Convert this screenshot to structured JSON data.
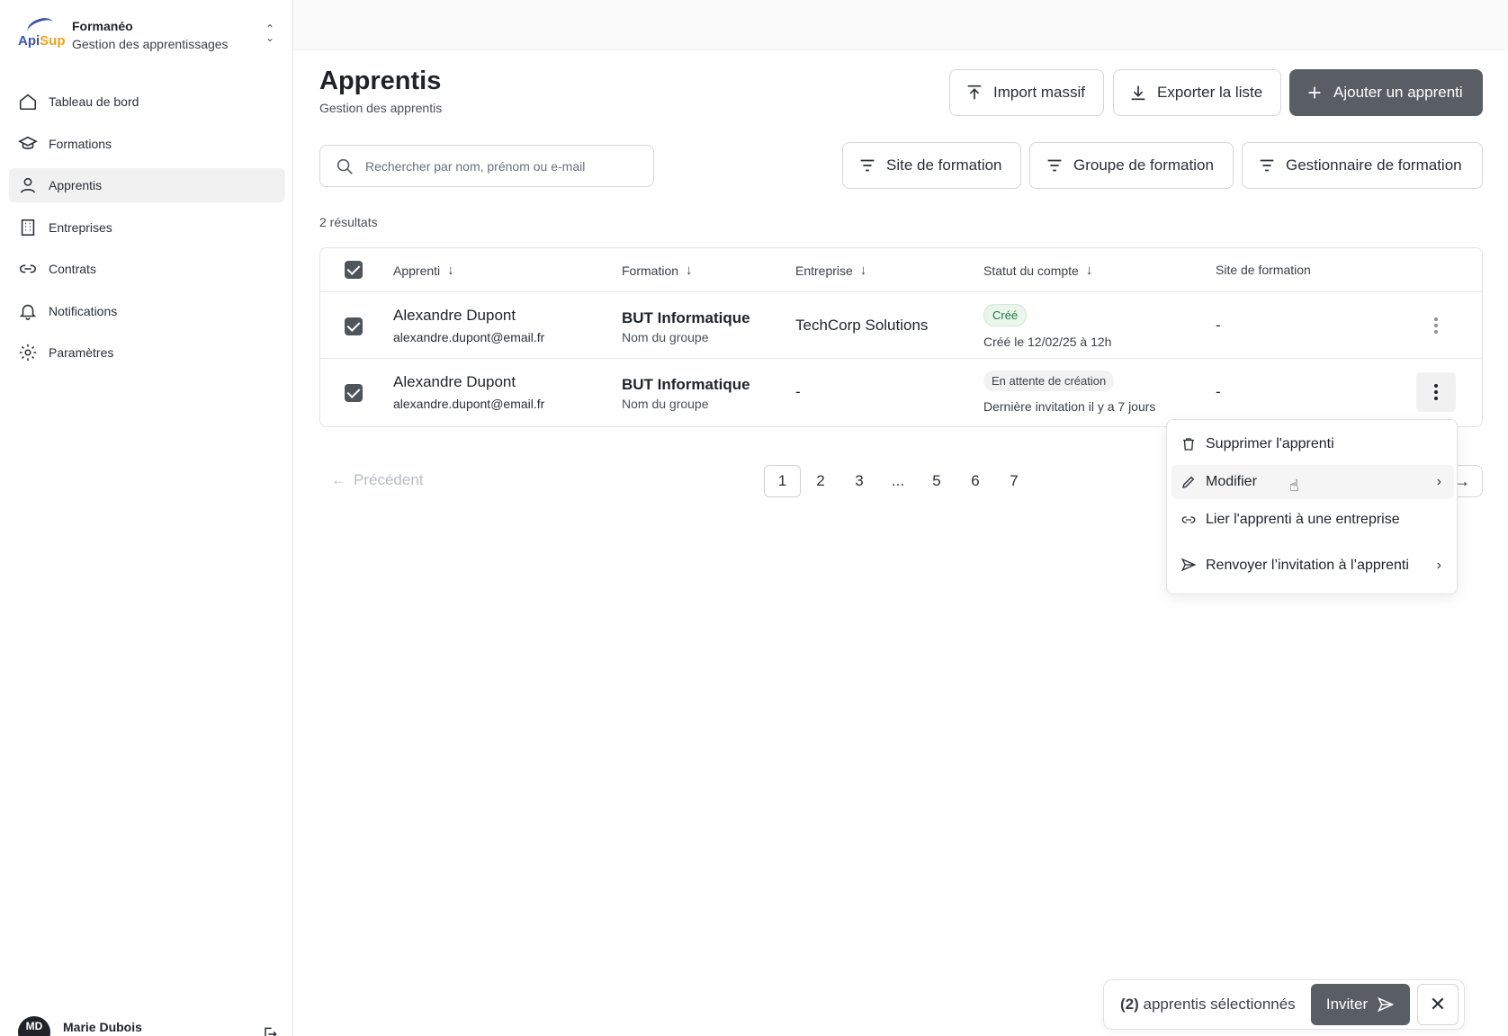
{
  "org": {
    "logo_text_a": "Api",
    "logo_text_b": "Sup",
    "name": "Formanéo",
    "subtitle": "Gestion des apprentissages"
  },
  "nav": [
    {
      "label": "Tableau de bord",
      "icon": "home-icon"
    },
    {
      "label": "Formations",
      "icon": "graduation-cap-icon"
    },
    {
      "label": "Apprentis",
      "icon": "user-icon",
      "active": true
    },
    {
      "label": "Entreprises",
      "icon": "building-icon"
    },
    {
      "label": "Contrats",
      "icon": "link-icon"
    },
    {
      "label": "Notifications",
      "icon": "bell-icon"
    },
    {
      "label": "Paramètres",
      "icon": "gear-icon"
    }
  ],
  "user": {
    "initials": "MD",
    "name": "Marie Dubois"
  },
  "header": {
    "title": "Apprentis",
    "subtitle": "Gestion des apprentis"
  },
  "actions": {
    "import": "Import massif",
    "export": "Exporter la liste",
    "add": "Ajouter un apprenti"
  },
  "search": {
    "placeholder": "Rechercher par nom, prénom ou e-mail",
    "value": ""
  },
  "filters": {
    "site": "Site de formation",
    "groupe": "Groupe de formation",
    "gestionnaire": "Gestionnaire de formation"
  },
  "results": "2 résultats",
  "table": {
    "columns": [
      "Apprenti",
      "Formation",
      "Entreprise",
      "Statut du compte",
      "Site de formation"
    ],
    "rows": [
      {
        "name": "Alexandre Dupont",
        "email": "alexandre.dupont@email.fr",
        "formation": "BUT Informatique",
        "groupe": "Nom du groupe",
        "entreprise": "TechCorp Solutions",
        "statut": "Créé",
        "statut_sub": "Créé le 12/02/25 à 12h",
        "site": "-",
        "checked": true
      },
      {
        "name": "Alexandre Dupont",
        "email": "alexandre.dupont@email.fr",
        "formation": "BUT Informatique",
        "groupe": "Nom du groupe",
        "entreprise": "-",
        "statut": "En attente de création",
        "statut_sub": "Dernière invitation il y a 7 jours",
        "site": "-",
        "checked": true
      }
    ]
  },
  "pagination": {
    "prev": "Précédent",
    "pages": [
      "1",
      "2",
      "3",
      "...",
      "5",
      "6",
      "7"
    ],
    "current": "1"
  },
  "menu": {
    "delete": "Supprimer l'apprenti",
    "edit": "Modifier",
    "link": "Lier l'apprenti à une entreprise",
    "resend": "Renvoyer l’invitation à l’apprenti"
  },
  "selection": {
    "count": "(2)",
    "text": "apprentis sélectionnés",
    "invite": "Inviter"
  },
  "colors": {
    "primary_button": "#595e64",
    "badge_green": "#1f7a3a"
  }
}
